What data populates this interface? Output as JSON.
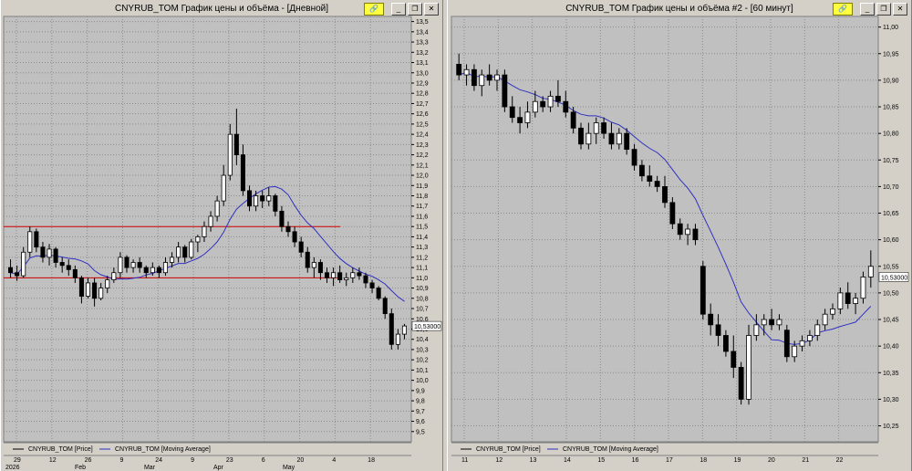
{
  "windows": [
    {
      "title": "CNYRUB_TOM График цены и объёма - [Дневной]",
      "price_label": "10,53000",
      "legend": [
        {
          "label": "CNYRUB_TOM [Price]",
          "color": "#000000"
        },
        {
          "label": "CNYRUB_TOM [Moving Average]",
          "color": "#3030c0"
        }
      ],
      "date_ticks": [
        "29",
        "12",
        "26",
        "9",
        "24",
        "9",
        "23",
        "6",
        "20",
        "4",
        "18"
      ],
      "month_labels": [
        "2026",
        "Feb",
        "Mar",
        "Apr",
        "May"
      ]
    },
    {
      "title": "CNYRUB_TOM График цены и объёма #2 - [60 минут]",
      "price_label": "10,53000",
      "legend": [
        {
          "label": "CNYRUB_TOM [Price]",
          "color": "#000000"
        },
        {
          "label": "CNYRUB_TOM [Moving Average]",
          "color": "#3030c0"
        }
      ],
      "date_ticks": [
        "11",
        "12",
        "13",
        "14",
        "15",
        "16",
        "17",
        "18",
        "19",
        "20",
        "21",
        "22"
      ],
      "month_labels": []
    }
  ],
  "chart_data": [
    {
      "type": "candlestick",
      "title": "CNYRUB_TOM График цены и объёма - [Дневной]",
      "yticks": [
        "13,5",
        "13,4",
        "13,3",
        "13,2",
        "13,1",
        "13,0",
        "12,9",
        "12,8",
        "12,7",
        "12,6",
        "12,5",
        "12,4",
        "12,3",
        "12,2",
        "12,1",
        "12,0",
        "11,9",
        "11,8",
        "11,7",
        "11,6",
        "11,5",
        "11,4",
        "11,3",
        "11,2",
        "11,1",
        "11,0",
        "10,9",
        "10,8",
        "10,7",
        "10,6",
        "10,5",
        "10,4",
        "10,3",
        "10,2",
        "10,1",
        "10,0",
        "9,9",
        "9,8",
        "9,7",
        "9,6",
        "9,5"
      ],
      "ylim": [
        9.4,
        13.55
      ],
      "last_price": 10.53,
      "horizontal_lines": [
        {
          "y": 11.5,
          "color": "#d00000"
        },
        {
          "y": 11.0,
          "color": "#d00000"
        }
      ],
      "candles": [
        [
          11.1,
          11.18,
          11.0,
          11.05
        ],
        [
          11.05,
          11.12,
          10.97,
          11.02
        ],
        [
          11.02,
          11.3,
          11.0,
          11.25
        ],
        [
          11.25,
          11.5,
          11.2,
          11.45
        ],
        [
          11.45,
          11.48,
          11.25,
          11.3
        ],
        [
          11.3,
          11.35,
          11.15,
          11.2
        ],
        [
          11.2,
          11.33,
          11.12,
          11.28
        ],
        [
          11.28,
          11.3,
          11.1,
          11.15
        ],
        [
          11.15,
          11.2,
          11.05,
          11.12
        ],
        [
          11.12,
          11.18,
          11.02,
          11.08
        ],
        [
          11.08,
          11.12,
          10.95,
          11.0
        ],
        [
          11.0,
          11.02,
          10.75,
          10.82
        ],
        [
          10.82,
          11.0,
          10.8,
          10.95
        ],
        [
          10.95,
          11.0,
          10.72,
          10.8
        ],
        [
          10.8,
          10.95,
          10.78,
          10.9
        ],
        [
          10.9,
          11.02,
          10.85,
          10.98
        ],
        [
          10.98,
          11.1,
          10.95,
          11.05
        ],
        [
          11.05,
          11.25,
          11.0,
          11.2
        ],
        [
          11.2,
          11.22,
          11.05,
          11.1
        ],
        [
          11.1,
          11.18,
          11.05,
          11.15
        ],
        [
          11.15,
          11.2,
          11.05,
          11.1
        ],
        [
          11.1,
          11.12,
          11.0,
          11.05
        ],
        [
          11.05,
          11.15,
          11.02,
          11.1
        ],
        [
          11.1,
          11.12,
          11.0,
          11.05
        ],
        [
          11.05,
          11.2,
          11.02,
          11.15
        ],
        [
          11.15,
          11.25,
          11.1,
          11.2
        ],
        [
          11.2,
          11.35,
          11.15,
          11.3
        ],
        [
          11.3,
          11.32,
          11.15,
          11.2
        ],
        [
          11.2,
          11.38,
          11.18,
          11.35
        ],
        [
          11.35,
          11.42,
          11.25,
          11.4
        ],
        [
          11.4,
          11.55,
          11.35,
          11.5
        ],
        [
          11.5,
          11.65,
          11.45,
          11.6
        ],
        [
          11.6,
          11.8,
          11.55,
          11.75
        ],
        [
          11.75,
          12.1,
          11.7,
          12.0
        ],
        [
          12.0,
          12.5,
          11.95,
          12.4
        ],
        [
          12.4,
          12.65,
          12.1,
          12.2
        ],
        [
          12.2,
          12.3,
          11.8,
          11.85
        ],
        [
          11.85,
          11.9,
          11.65,
          11.7
        ],
        [
          11.7,
          11.85,
          11.65,
          11.8
        ],
        [
          11.8,
          11.85,
          11.68,
          11.75
        ],
        [
          11.75,
          11.88,
          11.7,
          11.8
        ],
        [
          11.8,
          11.82,
          11.6,
          11.65
        ],
        [
          11.65,
          11.7,
          11.45,
          11.5
        ],
        [
          11.5,
          11.55,
          11.4,
          11.45
        ],
        [
          11.45,
          11.5,
          11.3,
          11.35
        ],
        [
          11.35,
          11.4,
          11.2,
          11.25
        ],
        [
          11.25,
          11.3,
          11.05,
          11.1
        ],
        [
          11.1,
          11.2,
          11.0,
          11.15
        ],
        [
          11.15,
          11.18,
          10.98,
          11.05
        ],
        [
          11.05,
          11.1,
          10.95,
          11.0
        ],
        [
          11.0,
          11.1,
          10.92,
          11.05
        ],
        [
          11.05,
          11.12,
          10.95,
          10.98
        ],
        [
          10.98,
          11.05,
          10.92,
          11.0
        ],
        [
          11.0,
          11.1,
          10.95,
          11.05
        ],
        [
          11.05,
          11.1,
          10.98,
          11.02
        ],
        [
          11.02,
          11.05,
          10.9,
          10.95
        ],
        [
          10.95,
          10.98,
          10.85,
          10.9
        ],
        [
          10.9,
          10.92,
          10.78,
          10.8
        ],
        [
          10.8,
          10.82,
          10.6,
          10.65
        ],
        [
          10.65,
          10.7,
          10.3,
          10.35
        ],
        [
          10.35,
          10.5,
          10.3,
          10.45
        ],
        [
          10.45,
          10.55,
          10.4,
          10.53
        ]
      ]
    },
    {
      "type": "candlestick",
      "title": "CNYRUB_TOM График цены и объёма #2 - [60 минут]",
      "yticks": [
        "11,00",
        "10,95",
        "10,90",
        "10,85",
        "10,80",
        "10,75",
        "10,70",
        "10,65",
        "10,60",
        "10,55",
        "10,50",
        "10,45",
        "10,40",
        "10,35",
        "10,30",
        "10,25"
      ],
      "ylim": [
        10.22,
        11.02
      ],
      "last_price": 10.53,
      "candles": [
        [
          10.93,
          10.95,
          10.9,
          10.91
        ],
        [
          10.91,
          10.93,
          10.89,
          10.92
        ],
        [
          10.92,
          10.93,
          10.88,
          10.89
        ],
        [
          10.89,
          10.92,
          10.87,
          10.91
        ],
        [
          10.91,
          10.93,
          10.89,
          10.9
        ],
        [
          10.9,
          10.92,
          10.88,
          10.91
        ],
        [
          10.91,
          10.92,
          10.84,
          10.85
        ],
        [
          10.85,
          10.87,
          10.82,
          10.83
        ],
        [
          10.83,
          10.85,
          10.8,
          10.82
        ],
        [
          10.82,
          10.86,
          10.81,
          10.84
        ],
        [
          10.84,
          10.88,
          10.83,
          10.86
        ],
        [
          10.86,
          10.87,
          10.84,
          10.85
        ],
        [
          10.85,
          10.88,
          10.84,
          10.87
        ],
        [
          10.87,
          10.9,
          10.85,
          10.86
        ],
        [
          10.86,
          10.88,
          10.83,
          10.84
        ],
        [
          10.84,
          10.85,
          10.8,
          10.81
        ],
        [
          10.81,
          10.82,
          10.77,
          10.78
        ],
        [
          10.78,
          10.82,
          10.77,
          10.8
        ],
        [
          10.8,
          10.83,
          10.78,
          10.82
        ],
        [
          10.82,
          10.83,
          10.79,
          10.8
        ],
        [
          10.8,
          10.82,
          10.77,
          10.78
        ],
        [
          10.78,
          10.81,
          10.77,
          10.8
        ],
        [
          10.8,
          10.81,
          10.76,
          10.77
        ],
        [
          10.77,
          10.78,
          10.73,
          10.74
        ],
        [
          10.74,
          10.75,
          10.71,
          10.72
        ],
        [
          10.72,
          10.74,
          10.7,
          10.71
        ],
        [
          10.71,
          10.72,
          10.69,
          10.7
        ],
        [
          10.7,
          10.72,
          10.66,
          10.67
        ],
        [
          10.67,
          10.68,
          10.62,
          10.63
        ],
        [
          10.63,
          10.64,
          10.6,
          10.61
        ],
        [
          10.61,
          10.63,
          10.59,
          10.62
        ],
        [
          10.62,
          10.63,
          10.59,
          10.6
        ],
        [
          10.55,
          10.56,
          10.45,
          10.46
        ],
        [
          10.46,
          10.48,
          10.42,
          10.44
        ],
        [
          10.44,
          10.46,
          10.4,
          10.42
        ],
        [
          10.42,
          10.43,
          10.38,
          10.39
        ],
        [
          10.39,
          10.42,
          10.34,
          10.36
        ],
        [
          10.36,
          10.37,
          10.29,
          10.3
        ],
        [
          10.3,
          10.44,
          10.29,
          10.42
        ],
        [
          10.42,
          10.46,
          10.41,
          10.44
        ],
        [
          10.44,
          10.46,
          10.42,
          10.45
        ],
        [
          10.45,
          10.47,
          10.43,
          10.44
        ],
        [
          10.44,
          10.46,
          10.43,
          10.45
        ],
        [
          10.43,
          10.44,
          10.37,
          10.38
        ],
        [
          10.38,
          10.41,
          10.37,
          10.4
        ],
        [
          10.4,
          10.42,
          10.39,
          10.41
        ],
        [
          10.41,
          10.43,
          10.4,
          10.42
        ],
        [
          10.42,
          10.45,
          10.41,
          10.44
        ],
        [
          10.44,
          10.47,
          10.43,
          10.46
        ],
        [
          10.46,
          10.48,
          10.45,
          10.47
        ],
        [
          10.47,
          10.51,
          10.46,
          10.5
        ],
        [
          10.5,
          10.52,
          10.47,
          10.48
        ],
        [
          10.48,
          10.5,
          10.46,
          10.49
        ],
        [
          10.49,
          10.54,
          10.48,
          10.53
        ],
        [
          10.53,
          10.58,
          10.51,
          10.55
        ]
      ]
    }
  ]
}
